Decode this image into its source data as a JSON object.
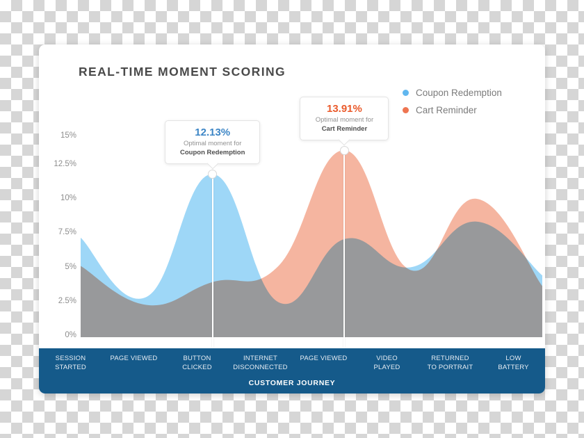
{
  "header": {
    "title": "REAL-TIME MOMENT SCORING"
  },
  "legend": {
    "position": "top-right",
    "items": [
      {
        "label": "Coupon Redemption",
        "color": "#61b7ef",
        "dot": "legend-dot-blue"
      },
      {
        "label": "Cart Reminder",
        "color": "#ee7551",
        "dot": "legend-dot-orange"
      }
    ]
  },
  "tooltips": [
    {
      "value": "12.13%",
      "subtitle": "Optimal moment for",
      "series": "Coupon Redemption",
      "value_color": "#3d86c6"
    },
    {
      "value": "13.91%",
      "subtitle": "Optimal moment for",
      "series": "Cart Reminder",
      "value_color": "#ea5b2c"
    }
  ],
  "journey": {
    "caption": "CUSTOMER JOURNEY",
    "bar_color": "#155a8a",
    "steps": [
      "SESSION\nSTARTED",
      "PAGE VIEWED",
      "BUTTON\nCLICKED",
      "INTERNET\nDISCONNECTED",
      "PAGE VIEWED",
      "VIDEO\nPLAYED",
      "RETURNED\nTO PORTRAIT",
      "LOW\nBATTERY"
    ]
  },
  "chart_data": {
    "type": "area",
    "title": "REAL-TIME MOMENT SCORING",
    "xlabel": "CUSTOMER JOURNEY",
    "ylabel": "",
    "grid": false,
    "ylim": [
      0,
      15
    ],
    "yticks": [
      "0%",
      "2.5%",
      "5%",
      "7.5%",
      "10%",
      "12.5%",
      "15%"
    ],
    "ytick_values": [
      0,
      2.5,
      5,
      7.5,
      10,
      12.5,
      15
    ],
    "categories": [
      "SESSION STARTED",
      "PAGE VIEWED",
      "BUTTON CLICKED",
      "INTERNET DISCONNECTED",
      "PAGE VIEWED",
      "VIDEO PLAYED",
      "RETURNED TO PORTRAIT",
      "LOW BATTERY"
    ],
    "series": [
      {
        "name": "Coupon Redemption",
        "color": "#9ed7f7",
        "line_color": "#61b7ef",
        "values": [
          7.4,
          3.0,
          12.13,
          2.6,
          7.3,
          5.2,
          8.6,
          4.6
        ],
        "peak": {
          "category": "BUTTON CLICKED",
          "value": 12.13,
          "label": "12.13%"
        }
      },
      {
        "name": "Cart Reminder",
        "color": "#f5b5a0",
        "line_color": "#ee7551",
        "values": [
          5.3,
          2.4,
          4.1,
          5.3,
          13.91,
          5.0,
          10.3,
          3.8
        ],
        "peak": {
          "category": "PAGE VIEWED",
          "value": 13.91,
          "label": "13.91%"
        }
      }
    ],
    "overlap_color": "#aabcd6",
    "annotations": [
      {
        "text": "12.13% Optimal moment for Coupon Redemption",
        "at": "BUTTON CLICKED"
      },
      {
        "text": "13.91% Optimal moment for Cart Reminder",
        "at": "PAGE VIEWED"
      }
    ]
  }
}
